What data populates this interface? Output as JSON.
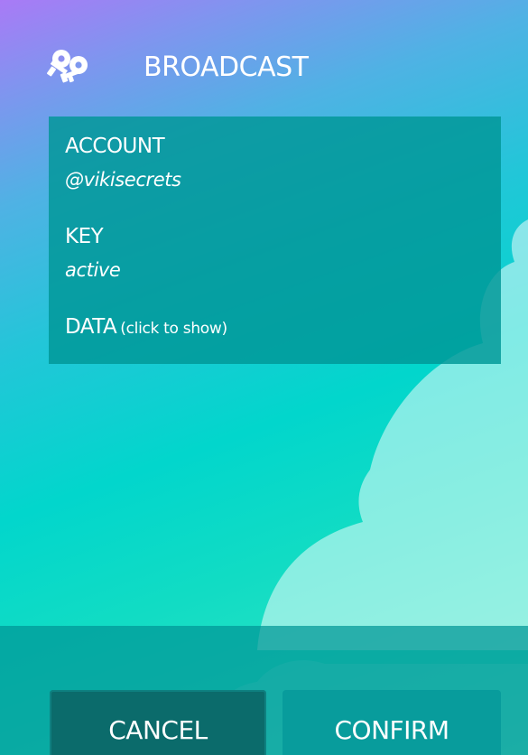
{
  "header": {
    "icon": "keys-icon",
    "title": "BROADCAST"
  },
  "details": {
    "account_label": "ACCOUNT",
    "account_value": "@vikisecrets",
    "key_label": "KEY",
    "key_value": "active",
    "data_label": "DATA",
    "data_hint": "(click to show)"
  },
  "actions": {
    "cancel_label": "CANCEL",
    "confirm_label": "CONFIRM"
  },
  "colors": {
    "gradient_top": "#a97af6",
    "gradient_bottom": "#3fe7c6",
    "card": "#009999",
    "cancel_button": "#0b6b6b",
    "confirm_button": "#089c9c"
  }
}
